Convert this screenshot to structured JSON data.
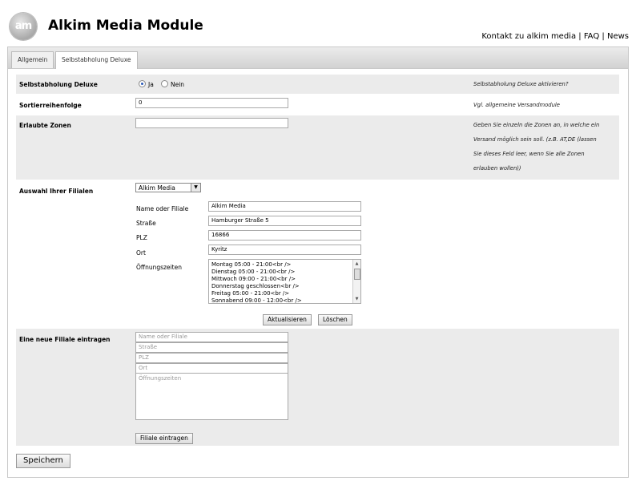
{
  "header": {
    "logo_text": "am",
    "title": "Alkim Media Module",
    "links": [
      "Kontakt zu alkim media",
      "FAQ",
      "News"
    ],
    "separator": "|"
  },
  "tabs": [
    {
      "label": "Allgemein",
      "active": false
    },
    {
      "label": "Selbstabholung Deluxe",
      "active": true
    }
  ],
  "settings": {
    "enabled": {
      "label": "Selbstabholung Deluxe",
      "options": [
        "Ja",
        "Nein"
      ],
      "selected": "Ja",
      "hint": "Selbstabholung Deluxe aktivieren?"
    },
    "sort_order": {
      "label": "Sortierreihenfolge",
      "value": "0",
      "hint": "Vgl. allgemeine Versandmodule"
    },
    "zones": {
      "label": "Erlaubte Zonen",
      "value": "",
      "hint_lines": [
        "Geben Sie einzeln die Zonen an, in welche ein",
        "Versand möglich sein soll. (z.B. AT,DE (lassen",
        "Sie dieses Feld leer, wenn Sie alle Zonen",
        "erlauben wollen))"
      ]
    }
  },
  "branches": {
    "label": "Auswahl Ihrer Filialen",
    "selected": "Alkim Media",
    "fields": {
      "name": {
        "label": "Name oder Filiale",
        "value": "Alkim Media"
      },
      "street": {
        "label": "Straße",
        "value": "Hamburger Straße 5"
      },
      "zip": {
        "label": "PLZ",
        "value": "16866"
      },
      "city": {
        "label": "Ort",
        "value": "Kyritz"
      },
      "hours": {
        "label": "Öffnungszeiten",
        "lines": [
          "Montag 05:00 - 21:00<br />",
          "Dienstag 05:00 - 21:00<br />",
          "Mittwoch 09:00 - 21:00<br />",
          "Donnerstag geschlossen<br />",
          "Freitag 05:00 - 21:00<br />",
          "Sonnabend 09:00 - 12:00<br />"
        ]
      }
    },
    "update_label": "Aktualisieren",
    "delete_label": "Löschen"
  },
  "new_branch": {
    "label": "Eine neue Filiale eintragen",
    "placeholders": {
      "name": "Name oder Filiale",
      "street": "Straße",
      "zip": "PLZ",
      "city": "Ort",
      "hours": "Öffnungszeiten"
    },
    "submit_label": "Filiale eintragen"
  },
  "save_label": "Speichern"
}
